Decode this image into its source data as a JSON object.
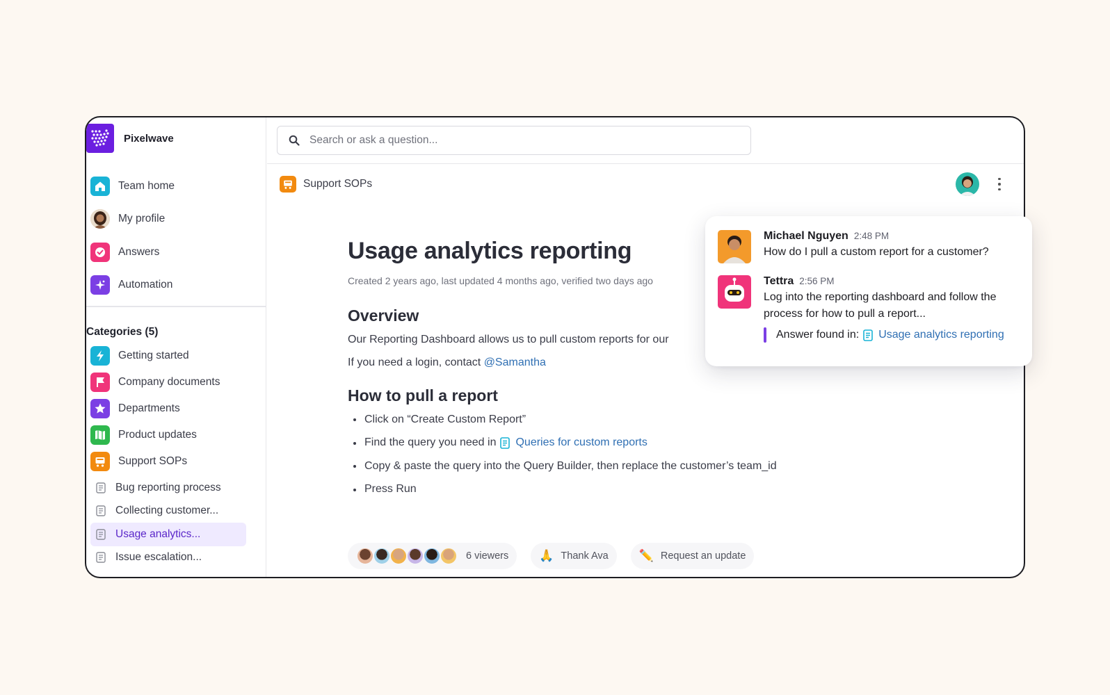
{
  "app": {
    "name": "Pixelwave"
  },
  "nav": [
    {
      "label": "Team home",
      "icon": "home-icon",
      "color": "#19b3d6"
    },
    {
      "label": "My profile",
      "icon": "avatar",
      "color": "#c9a27a"
    },
    {
      "label": "Answers",
      "icon": "chat-check-icon",
      "color": "#f0347a"
    },
    {
      "label": "Automation",
      "icon": "sparkle-icon",
      "color": "#7b3fe4"
    }
  ],
  "categories": {
    "heading": "Categories (5)",
    "items": [
      {
        "label": "Getting started",
        "icon": "bolt-icon",
        "color": "#19b3d6"
      },
      {
        "label": "Company documents",
        "icon": "flag-icon",
        "color": "#f0347a"
      },
      {
        "label": "Departments",
        "icon": "star-icon",
        "color": "#7b3fe4"
      },
      {
        "label": "Product updates",
        "icon": "map-icon",
        "color": "#2fb84e"
      },
      {
        "label": "Support SOPs",
        "icon": "cart-icon",
        "color": "#f28a0f"
      }
    ]
  },
  "docs": [
    {
      "label": "Bug reporting process",
      "active": false
    },
    {
      "label": "Collecting customer...",
      "active": false
    },
    {
      "label": "Usage analytics...",
      "active": true
    },
    {
      "label": "Issue escalation...",
      "active": false
    }
  ],
  "search": {
    "placeholder": "Search or ask a question..."
  },
  "breadcrumb": {
    "label": "Support SOPs"
  },
  "document": {
    "title": "Usage analytics reporting",
    "meta": "Created 2 years ago, last updated 4 months ago, verified two days ago",
    "overview_heading": "Overview",
    "overview_text": "Our Reporting Dashboard allows us to pull custom reports for our",
    "login_text": "If you need a login, contact ",
    "login_mention": "@Samantha",
    "howto_heading": "How to pull a report",
    "steps": {
      "step1": "Click on “Create Custom Report”",
      "step2_prefix": "Find the query you need in",
      "step2_link": "Queries for custom reports",
      "step3": "Copy & paste the query into the Query Builder, then replace the customer’s team_id",
      "step4": "Press Run"
    }
  },
  "footer": {
    "viewers": "6 viewers",
    "thank_emoji": "🙏",
    "thank": "Thank Ava",
    "request_emoji": "✏️",
    "request": "Request an update"
  },
  "chat": {
    "msg1": {
      "name": "Michael Nguyen",
      "time": "2:48 PM",
      "text": "How do I pull a custom report for a customer?"
    },
    "msg2": {
      "name": "Tettra",
      "time": "2:56 PM",
      "text": "Log into the reporting dashboard and follow the process for how to pull a report...",
      "answer_label": "Answer found in:",
      "answer_link": "Usage analytics reporting"
    }
  },
  "colors": {
    "accent": "#6b1fe0",
    "link": "#2f6fb3",
    "active_bg": "#efeaff"
  }
}
